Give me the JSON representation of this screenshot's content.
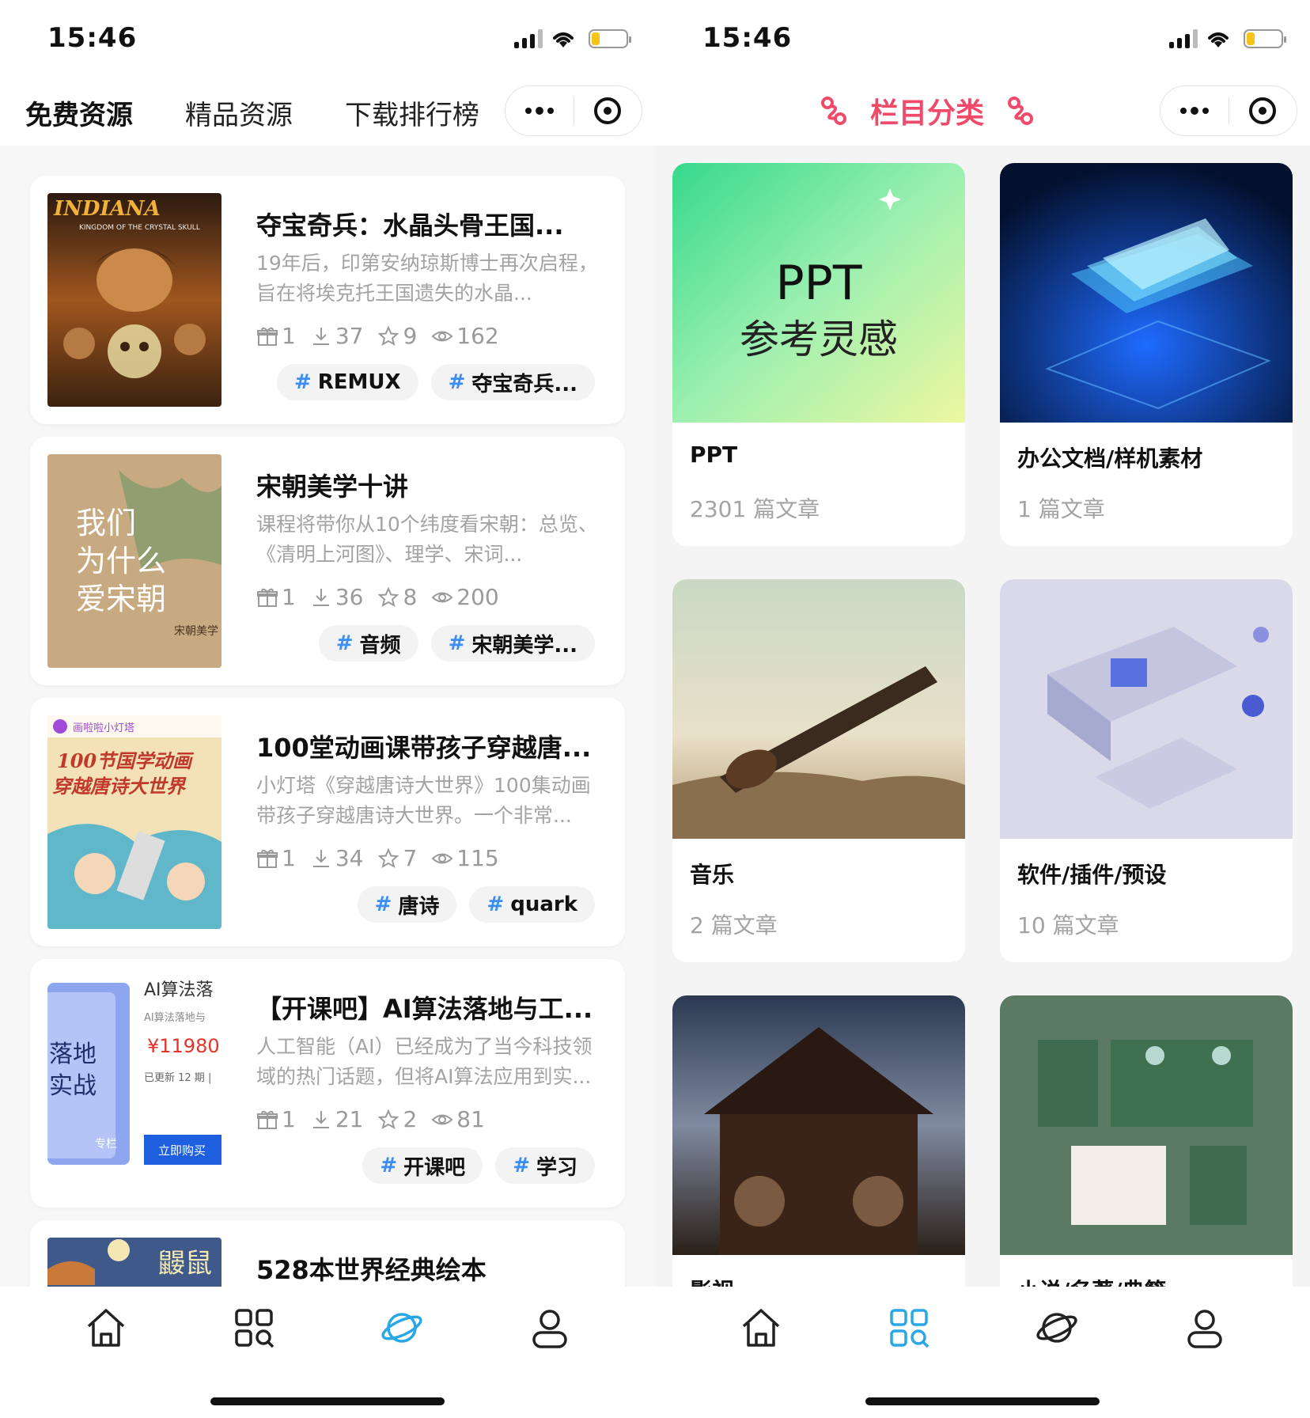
{
  "status": {
    "time": "15:46"
  },
  "left": {
    "tabs": [
      {
        "label": "免费资源",
        "active": true
      },
      {
        "label": "精品资源",
        "active": false
      },
      {
        "label": "下载排行榜",
        "active": false
      }
    ],
    "items": [
      {
        "title": "夺宝奇兵：水晶头骨王国...",
        "desc": "19年后，印第安纳琼斯博士再次启程，旨在将埃克托王国遗失的水晶...",
        "stats": {
          "gift": "1",
          "download": "37",
          "star": "9",
          "view": "162"
        },
        "tags": [
          "REMUX",
          "夺宝奇兵..."
        ],
        "thumb_text": "INDIANA JONES"
      },
      {
        "title": "宋朝美学十讲",
        "desc": "课程将带你从10个纬度看宋朝：总览、《清明上河图》、理学、宋词...",
        "stats": {
          "gift": "1",
          "download": "36",
          "star": "8",
          "view": "200"
        },
        "tags": [
          "音频",
          "宋朝美学..."
        ],
        "thumb_text": "我们为什么爱宋朝"
      },
      {
        "title": "100堂动画课带孩子穿越唐...",
        "desc": "小灯塔《穿越唐诗大世界》100集动画带孩子穿越唐诗大世界。一个非常...",
        "stats": {
          "gift": "1",
          "download": "34",
          "star": "7",
          "view": "115"
        },
        "tags": [
          "唐诗",
          "quark"
        ],
        "thumb_text": "100节国学动画 穿越唐诗大世界"
      },
      {
        "title": "【开课吧】AI算法落地与工...",
        "desc": "人工智能（AI）已经成为了当今科技领域的热门话题，但将AI算法应用到实...",
        "stats": {
          "gift": "1",
          "download": "21",
          "star": "2",
          "view": "81"
        },
        "tags": [
          "开课吧",
          "学习"
        ],
        "thumb_text": "AI算法落地 ¥11980"
      },
      {
        "title": "528本世界经典绘本",
        "desc": "",
        "stats": {
          "gift": "",
          "download": "",
          "star": "",
          "view": ""
        },
        "tags": [],
        "thumb_text": ""
      }
    ]
  },
  "right": {
    "title": "栏目分类",
    "categories": [
      {
        "title": "PPT",
        "count": "2301 篇文章",
        "img_text1": "PPT",
        "img_text2": "参考灵感"
      },
      {
        "title": "办公文档/样机素材",
        "count": "1 篇文章"
      },
      {
        "title": "音乐",
        "count": "2 篇文章"
      },
      {
        "title": "软件/插件/预设",
        "count": "10 篇文章"
      },
      {
        "title": "影视",
        "count": ""
      },
      {
        "title": "小说/名著/典籍",
        "count": ""
      }
    ]
  },
  "colors": {
    "accent": "#3a8ef6",
    "title_pink": "#f04a6a",
    "tag_hash": "#3a8ef6"
  }
}
